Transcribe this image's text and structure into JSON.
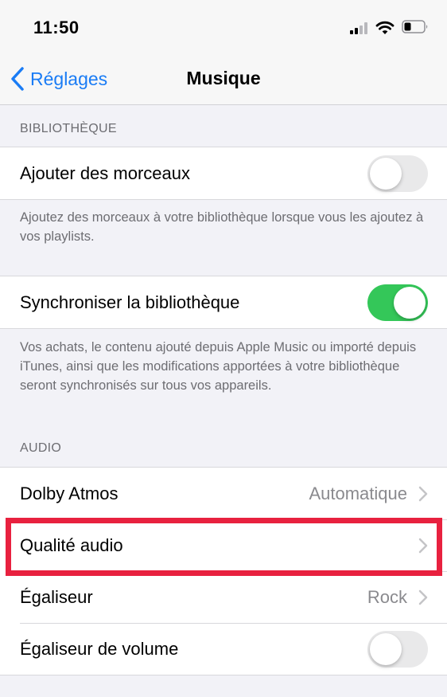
{
  "status_bar": {
    "time": "11:50",
    "icons": [
      "cellular-signal-icon",
      "wifi-icon",
      "battery-icon"
    ]
  },
  "nav": {
    "back_label": "Réglages",
    "title": "Musique"
  },
  "library_section": {
    "header": "BIBLIOTHÈQUE",
    "add_songs": {
      "label": "Ajouter des morceaux",
      "on": false
    },
    "add_songs_footer": "Ajoutez des morceaux à votre bibliothèque lorsque vous les ajoutez à vos playlists.",
    "sync_library": {
      "label": "Synchroniser la bibliothèque",
      "on": true
    },
    "sync_footer": "Vos achats, le contenu ajouté depuis Apple Music ou importé depuis iTunes, ainsi que les modifications apportées à votre bibliothèque seront synchronisés sur tous vos appareils."
  },
  "audio_section": {
    "header": "AUDIO",
    "dolby": {
      "label": "Dolby Atmos",
      "value": "Automatique"
    },
    "quality": {
      "label": "Qualité audio"
    },
    "eq": {
      "label": "Égaliseur",
      "value": "Rock"
    },
    "volume_eq": {
      "label": "Égaliseur de volume",
      "on": false
    }
  },
  "colors": {
    "accent": "#1a7cf5",
    "toggle_on": "#34c759",
    "highlight": "#e8213f"
  }
}
